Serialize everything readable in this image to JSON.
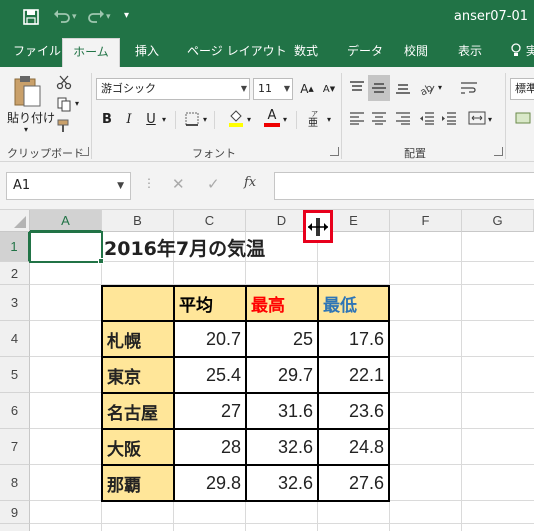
{
  "window": {
    "title": "anser07-01"
  },
  "qat": {
    "save_icon": "save-icon",
    "undo_icon": "undo-icon",
    "redo_icon": "redo-icon",
    "customize_icon": "customize-icon"
  },
  "tabs": [
    "ファイル",
    "ホーム",
    "挿入",
    "ページ レイアウト",
    "数式",
    "データ",
    "校閲",
    "表示"
  ],
  "tell_me_icon": "lightbulb-icon",
  "tell_me_text": "実",
  "ribbon": {
    "paste_label": "貼り付け",
    "clipboard_label": "クリップボード",
    "font_name": "游ゴシック",
    "font_size": "11",
    "font_group_label": "フォント",
    "bold": "B",
    "italic": "I",
    "underline": "U",
    "font_color_letter": "A",
    "align_group_label": "配置",
    "number_format": "標準"
  },
  "formula_bar": {
    "name_box": "A1",
    "cancel": "✕",
    "enter": "✓",
    "fx": "fx",
    "content": ""
  },
  "sheet": {
    "columns": [
      "A",
      "B",
      "C",
      "D",
      "E",
      "F",
      "G"
    ],
    "rows": [
      "1",
      "2",
      "3",
      "4",
      "5",
      "6",
      "7",
      "8",
      "9",
      "10"
    ],
    "title": "2016年7月の気温",
    "table_headers": [
      "平均",
      "最高",
      "最低"
    ],
    "table_rows": [
      {
        "city": "札幌",
        "avg": "20.7",
        "high": "25",
        "low": "17.6"
      },
      {
        "city": "東京",
        "avg": "25.4",
        "high": "29.7",
        "low": "22.1"
      },
      {
        "city": "名古屋",
        "avg": "27",
        "high": "31.6",
        "low": "23.6"
      },
      {
        "city": "大阪",
        "avg": "28",
        "high": "32.6",
        "low": "24.8"
      },
      {
        "city": "那覇",
        "avg": "29.8",
        "high": "32.6",
        "low": "27.6"
      }
    ]
  },
  "colors": {
    "excel_green": "#217346",
    "header_fill": "#ffe699",
    "max_text": "#ff0000",
    "min_text": "#2e75b6",
    "highlight_frame": "#e8001c"
  }
}
